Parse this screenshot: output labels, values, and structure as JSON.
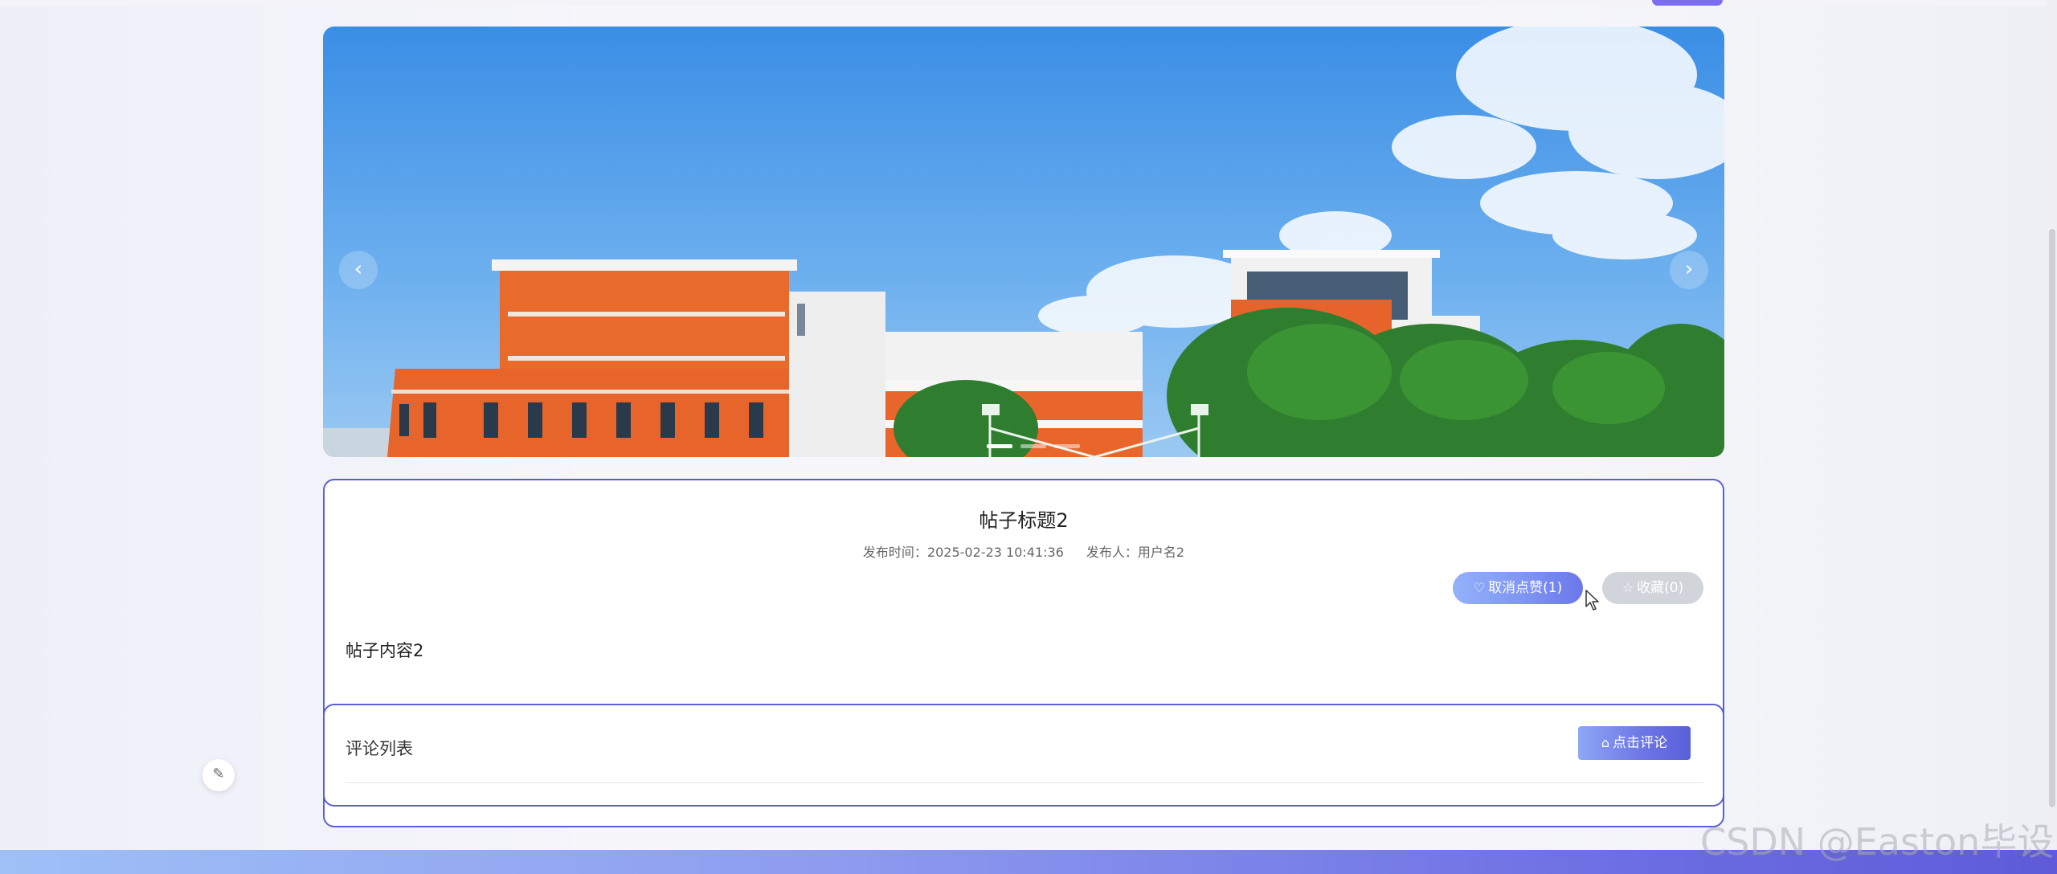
{
  "carousel": {
    "prev_label": "‹",
    "next_label": "›",
    "slides": 3,
    "active_index": 0
  },
  "post": {
    "title": "帖子标题2",
    "publish_time_label": "发布时间：",
    "publish_time": "2025-02-23 10:41:36",
    "author_label": "发布人：",
    "author": "用户名2",
    "content": "帖子内容2"
  },
  "actions": {
    "like_icon": "heart-icon",
    "like_label": "取消点赞(1)",
    "favorite_icon": "star-icon",
    "favorite_label": "收藏(0)"
  },
  "comments": {
    "title": "评论列表",
    "comment_icon": "comment-icon",
    "comment_button_label": "点击评论"
  },
  "watermark": "CSDN @Easton毕设",
  "colors": {
    "accent": "#5b5fd6",
    "like_bg": "#7f95f3",
    "favorite_bg": "#d2d4dc"
  }
}
